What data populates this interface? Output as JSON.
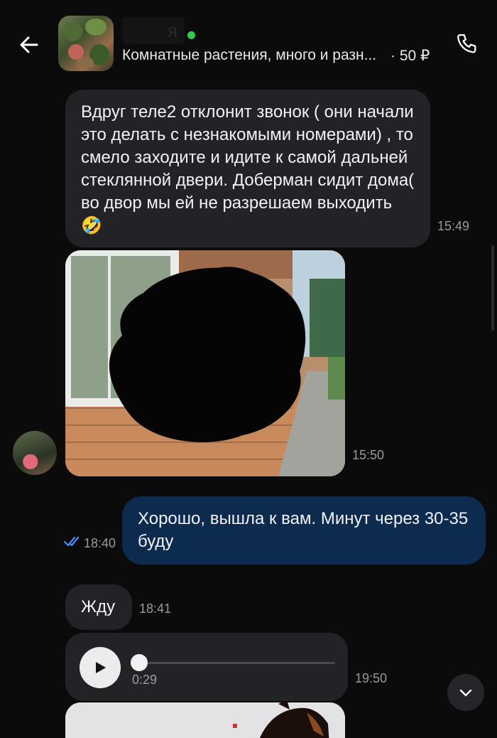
{
  "header": {
    "contact_name_fragment": "я",
    "listing_title": "Комнатные растения, много и разн...",
    "listing_price": "· 50 ₽",
    "online_color": "#2ecc52"
  },
  "messages": [
    {
      "direction": "in",
      "text": "Вдруг теле2  отклонит звонок ( они начали это делать с незнакомыми номерами) , то смело заходите и идите к самой дальней стеклянной двери. Доберман сидит дома( во двор мы ей не разрешаем выходить 🤣",
      "time": "15:49"
    },
    {
      "direction": "in",
      "type": "photo",
      "time": "15:50"
    },
    {
      "direction": "out",
      "text": "Хорошо, вышла к вам. Минут через 30-35 буду",
      "time": "18:40",
      "status": "read"
    },
    {
      "direction": "in",
      "text": "Жду",
      "time": "18:41"
    },
    {
      "direction": "in",
      "type": "voice",
      "duration": "0:29",
      "time": "19:50"
    },
    {
      "direction": "in",
      "type": "photo-partial"
    }
  ],
  "icons": {
    "back": "arrow-left-icon",
    "call": "phone-icon",
    "read": "double-check-icon",
    "play": "play-icon",
    "scroll": "chevron-down-icon"
  },
  "colors": {
    "background": "#0b0b0c",
    "incoming_bubble": "#232327",
    "outgoing_bubble": "#0d2a4f",
    "read_check": "#4a8cff"
  }
}
